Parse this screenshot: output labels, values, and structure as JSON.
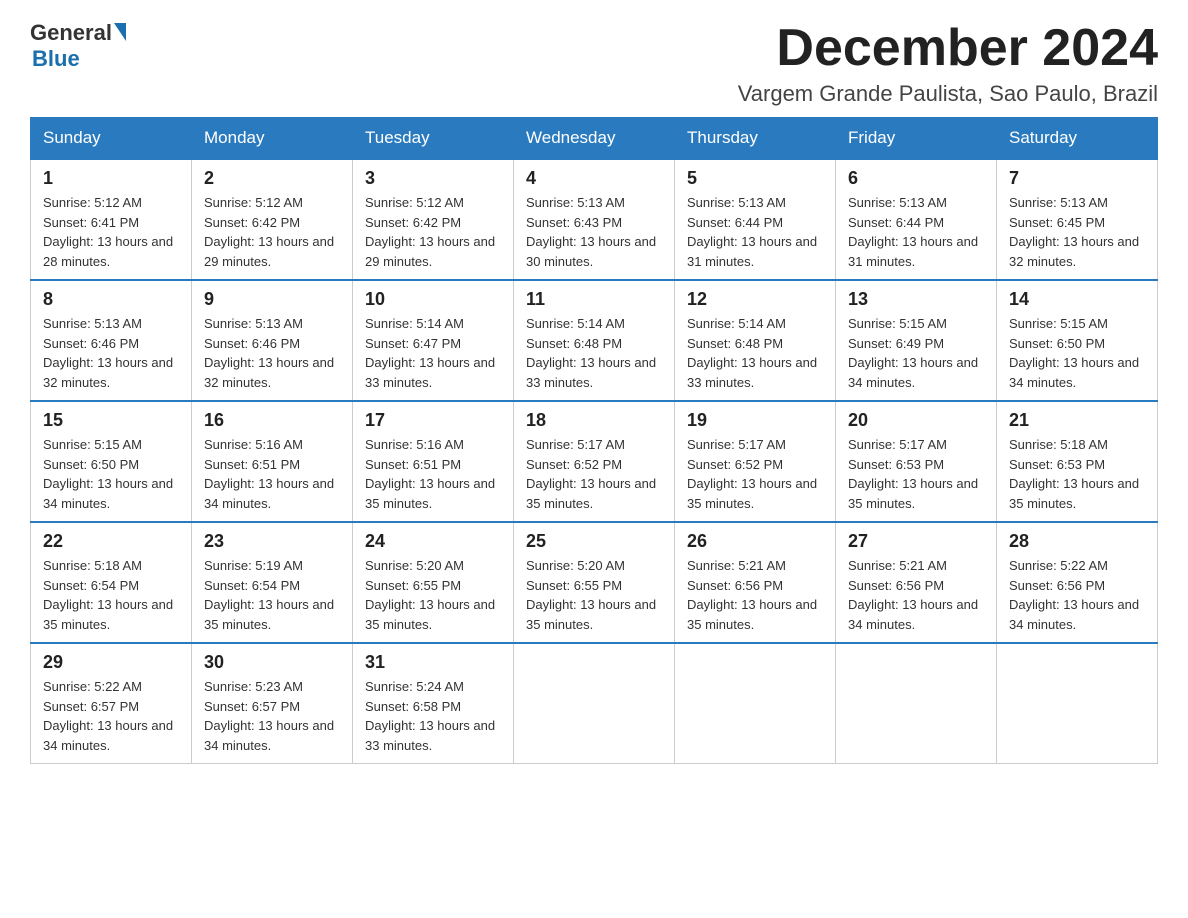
{
  "header": {
    "logo_general": "General",
    "logo_blue": "Blue",
    "month_title": "December 2024",
    "location": "Vargem Grande Paulista, Sao Paulo, Brazil"
  },
  "days_of_week": [
    "Sunday",
    "Monday",
    "Tuesday",
    "Wednesday",
    "Thursday",
    "Friday",
    "Saturday"
  ],
  "weeks": [
    [
      {
        "day": "1",
        "sunrise": "5:12 AM",
        "sunset": "6:41 PM",
        "daylight": "13 hours and 28 minutes."
      },
      {
        "day": "2",
        "sunrise": "5:12 AM",
        "sunset": "6:42 PM",
        "daylight": "13 hours and 29 minutes."
      },
      {
        "day": "3",
        "sunrise": "5:12 AM",
        "sunset": "6:42 PM",
        "daylight": "13 hours and 29 minutes."
      },
      {
        "day": "4",
        "sunrise": "5:13 AM",
        "sunset": "6:43 PM",
        "daylight": "13 hours and 30 minutes."
      },
      {
        "day": "5",
        "sunrise": "5:13 AM",
        "sunset": "6:44 PM",
        "daylight": "13 hours and 31 minutes."
      },
      {
        "day": "6",
        "sunrise": "5:13 AM",
        "sunset": "6:44 PM",
        "daylight": "13 hours and 31 minutes."
      },
      {
        "day": "7",
        "sunrise": "5:13 AM",
        "sunset": "6:45 PM",
        "daylight": "13 hours and 32 minutes."
      }
    ],
    [
      {
        "day": "8",
        "sunrise": "5:13 AM",
        "sunset": "6:46 PM",
        "daylight": "13 hours and 32 minutes."
      },
      {
        "day": "9",
        "sunrise": "5:13 AM",
        "sunset": "6:46 PM",
        "daylight": "13 hours and 32 minutes."
      },
      {
        "day": "10",
        "sunrise": "5:14 AM",
        "sunset": "6:47 PM",
        "daylight": "13 hours and 33 minutes."
      },
      {
        "day": "11",
        "sunrise": "5:14 AM",
        "sunset": "6:48 PM",
        "daylight": "13 hours and 33 minutes."
      },
      {
        "day": "12",
        "sunrise": "5:14 AM",
        "sunset": "6:48 PM",
        "daylight": "13 hours and 33 minutes."
      },
      {
        "day": "13",
        "sunrise": "5:15 AM",
        "sunset": "6:49 PM",
        "daylight": "13 hours and 34 minutes."
      },
      {
        "day": "14",
        "sunrise": "5:15 AM",
        "sunset": "6:50 PM",
        "daylight": "13 hours and 34 minutes."
      }
    ],
    [
      {
        "day": "15",
        "sunrise": "5:15 AM",
        "sunset": "6:50 PM",
        "daylight": "13 hours and 34 minutes."
      },
      {
        "day": "16",
        "sunrise": "5:16 AM",
        "sunset": "6:51 PM",
        "daylight": "13 hours and 34 minutes."
      },
      {
        "day": "17",
        "sunrise": "5:16 AM",
        "sunset": "6:51 PM",
        "daylight": "13 hours and 35 minutes."
      },
      {
        "day": "18",
        "sunrise": "5:17 AM",
        "sunset": "6:52 PM",
        "daylight": "13 hours and 35 minutes."
      },
      {
        "day": "19",
        "sunrise": "5:17 AM",
        "sunset": "6:52 PM",
        "daylight": "13 hours and 35 minutes."
      },
      {
        "day": "20",
        "sunrise": "5:17 AM",
        "sunset": "6:53 PM",
        "daylight": "13 hours and 35 minutes."
      },
      {
        "day": "21",
        "sunrise": "5:18 AM",
        "sunset": "6:53 PM",
        "daylight": "13 hours and 35 minutes."
      }
    ],
    [
      {
        "day": "22",
        "sunrise": "5:18 AM",
        "sunset": "6:54 PM",
        "daylight": "13 hours and 35 minutes."
      },
      {
        "day": "23",
        "sunrise": "5:19 AM",
        "sunset": "6:54 PM",
        "daylight": "13 hours and 35 minutes."
      },
      {
        "day": "24",
        "sunrise": "5:20 AM",
        "sunset": "6:55 PM",
        "daylight": "13 hours and 35 minutes."
      },
      {
        "day": "25",
        "sunrise": "5:20 AM",
        "sunset": "6:55 PM",
        "daylight": "13 hours and 35 minutes."
      },
      {
        "day": "26",
        "sunrise": "5:21 AM",
        "sunset": "6:56 PM",
        "daylight": "13 hours and 35 minutes."
      },
      {
        "day": "27",
        "sunrise": "5:21 AM",
        "sunset": "6:56 PM",
        "daylight": "13 hours and 34 minutes."
      },
      {
        "day": "28",
        "sunrise": "5:22 AM",
        "sunset": "6:56 PM",
        "daylight": "13 hours and 34 minutes."
      }
    ],
    [
      {
        "day": "29",
        "sunrise": "5:22 AM",
        "sunset": "6:57 PM",
        "daylight": "13 hours and 34 minutes."
      },
      {
        "day": "30",
        "sunrise": "5:23 AM",
        "sunset": "6:57 PM",
        "daylight": "13 hours and 34 minutes."
      },
      {
        "day": "31",
        "sunrise": "5:24 AM",
        "sunset": "6:58 PM",
        "daylight": "13 hours and 33 minutes."
      },
      null,
      null,
      null,
      null
    ]
  ],
  "labels": {
    "sunrise": "Sunrise: ",
    "sunset": "Sunset: ",
    "daylight": "Daylight: "
  }
}
